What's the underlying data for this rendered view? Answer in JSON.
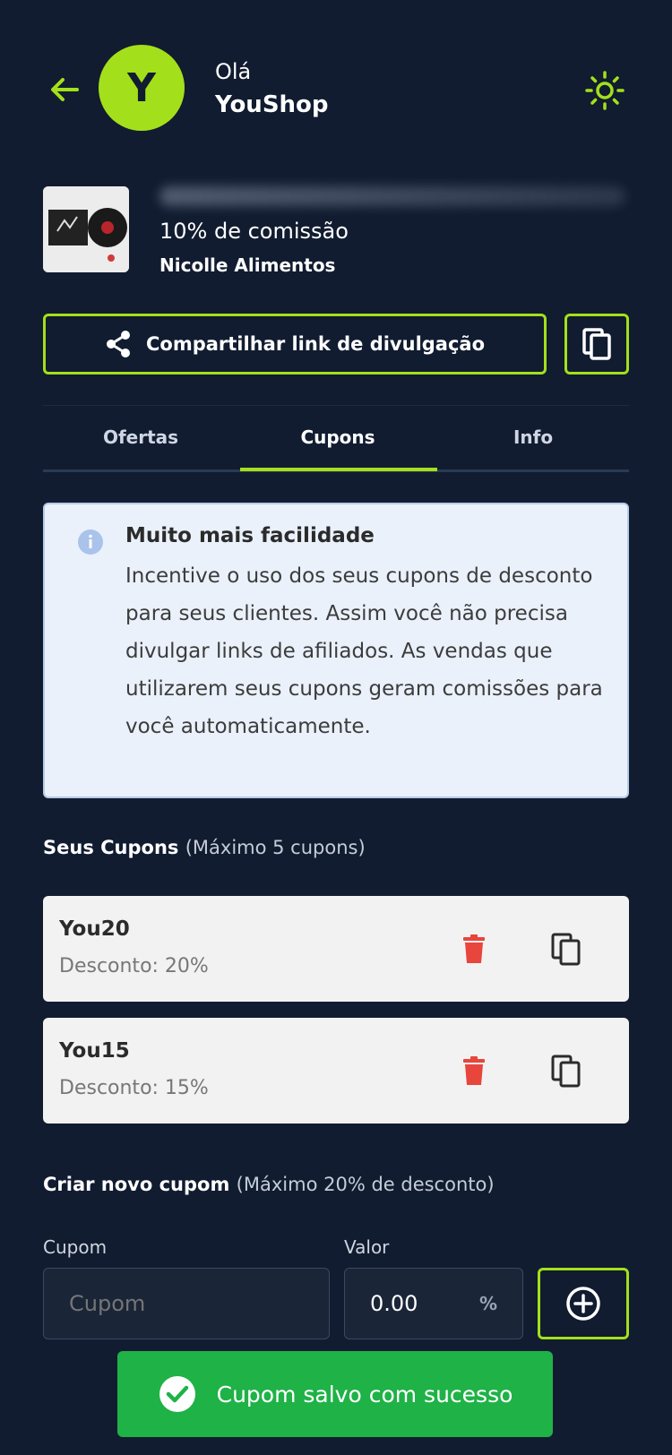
{
  "header": {
    "avatar_letter": "Y",
    "greeting": "Olá",
    "shop_name": "YouShop"
  },
  "product": {
    "commission": "10% de comissão",
    "seller": "Nicolle Alimentos"
  },
  "actions": {
    "share_label": "Compartilhar link de divulgação"
  },
  "tabs": [
    {
      "label": "Ofertas",
      "active": false
    },
    {
      "label": "Cupons",
      "active": true
    },
    {
      "label": "Info",
      "active": false
    }
  ],
  "info": {
    "title": "Muito mais facilidade",
    "text": "Incentive o uso dos seus cupons de desconto para seus clientes. Assim você não precisa divulgar links de afiliados. As vendas que utilizarem seus cupons geram comissões para você automaticamente."
  },
  "coupons_section": {
    "title": "Seus Cupons",
    "subtitle": "(Máximo 5 cupons)"
  },
  "coupons": [
    {
      "code": "You20",
      "discount": "Desconto: 20%"
    },
    {
      "code": "You15",
      "discount": "Desconto: 15%"
    }
  ],
  "create_section": {
    "title": "Criar novo cupom",
    "subtitle": "(Máximo 20% de desconto)",
    "cupom_label": "Cupom",
    "cupom_placeholder": "Cupom",
    "valor_label": "Valor",
    "valor_value": "0.00",
    "valor_unit": "%"
  },
  "toast": {
    "message": "Cupom salvo com sucesso"
  },
  "colors": {
    "background": "#111c30",
    "accent": "#a3e01b",
    "success": "#1fb247",
    "danger": "#e8453c"
  }
}
